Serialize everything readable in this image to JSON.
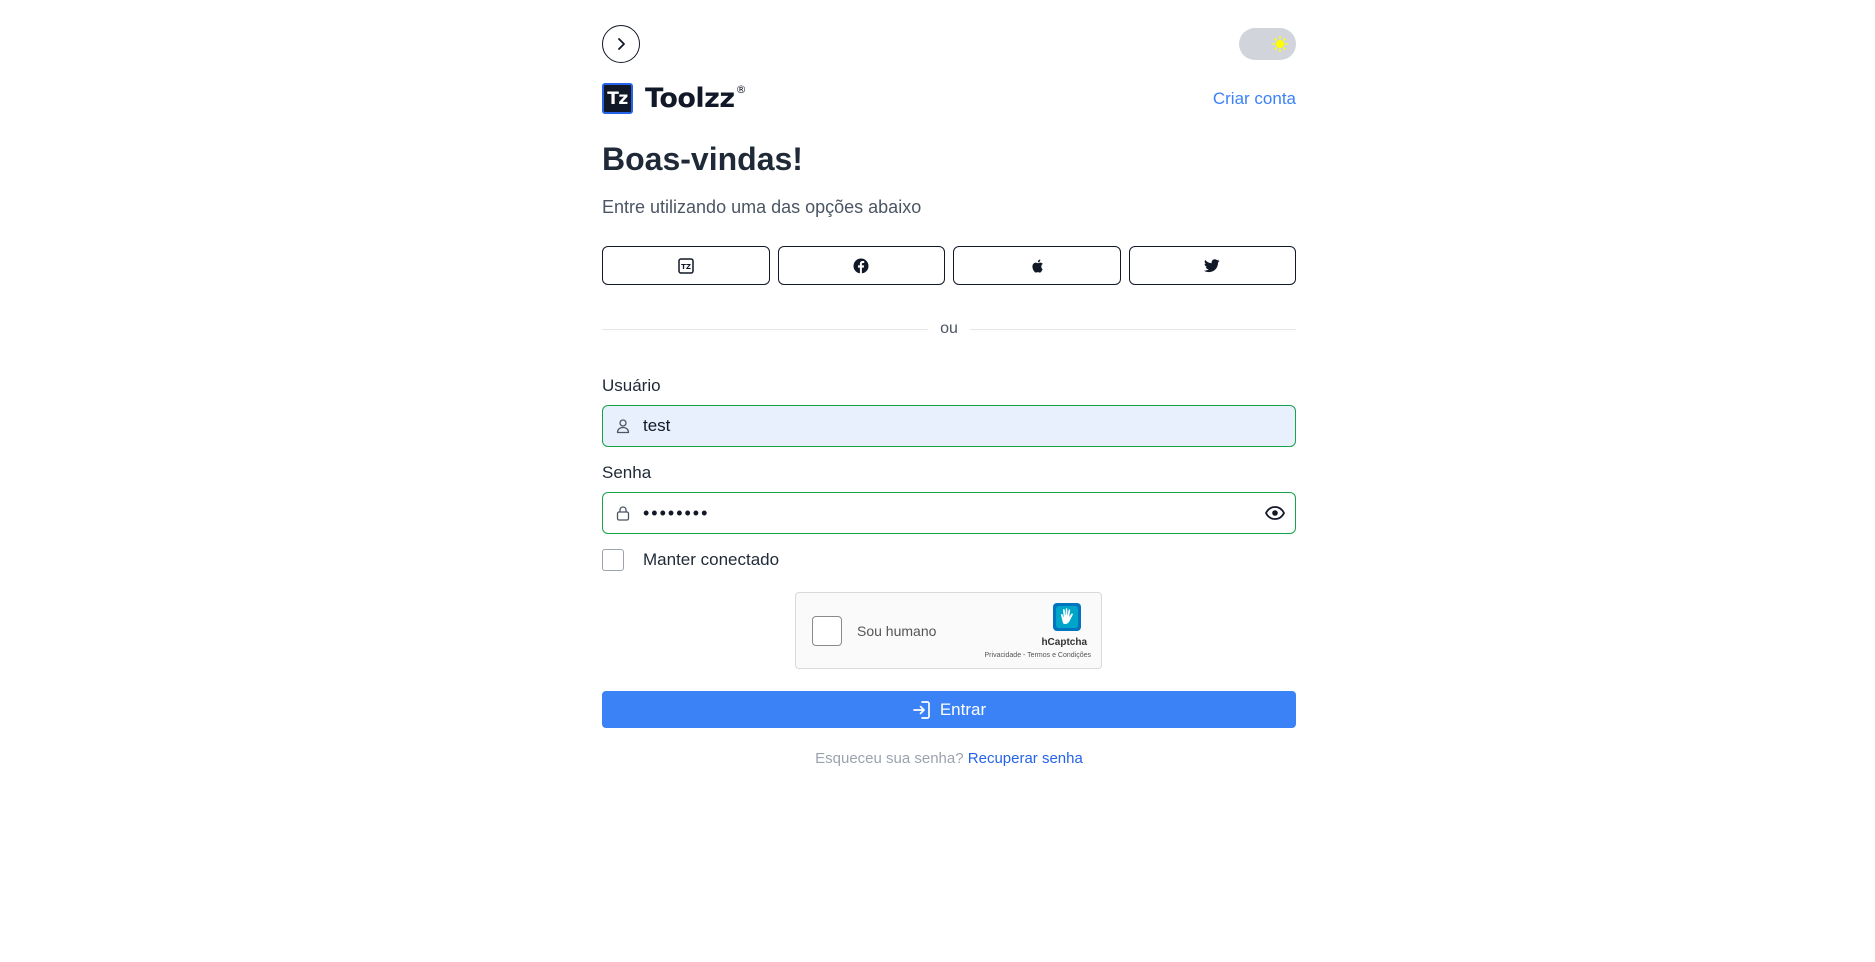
{
  "brand": {
    "logo_text": "Tz",
    "name": "Toolzz",
    "reg": "®"
  },
  "header": {
    "create_account": "Criar conta"
  },
  "main": {
    "title": "Boas-vindas!",
    "subtitle": "Entre utilizando uma das opções abaixo",
    "divider": "ou"
  },
  "social": [
    {
      "icon": "toolzz-icon"
    },
    {
      "icon": "facebook-icon"
    },
    {
      "icon": "apple-icon"
    },
    {
      "icon": "twitter-icon"
    }
  ],
  "form": {
    "username_label": "Usuário",
    "username_value": "test",
    "password_label": "Senha",
    "password_value": "password",
    "remember_label": "Manter conectado",
    "submit_label": "Entrar"
  },
  "captcha": {
    "label": "Sou humano",
    "brand": "hCaptcha",
    "links": "Privacidade - Termos e Condições"
  },
  "footer": {
    "forgot_question": "Esqueceu sua senha?",
    "recover_link": "Recuperar senha"
  },
  "colors": {
    "primary": "#3b82f6",
    "valid_border": "#16a34a",
    "autofill_bg": "#e8f0fe",
    "toggle_bg": "#d1d5db",
    "sun": "#ffff00"
  }
}
